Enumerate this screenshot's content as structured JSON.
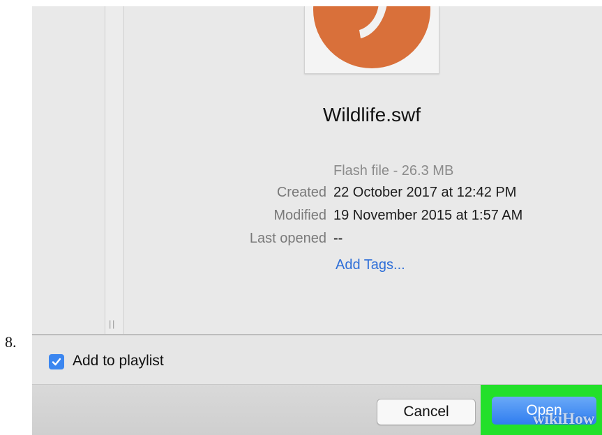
{
  "step": {
    "number": "8."
  },
  "file": {
    "name": "Wildlife.swf",
    "kind": "Flash file - 26.3 MB",
    "created_label": "Created",
    "created_value": "22 October 2017 at 12:42 PM",
    "modified_label": "Modified",
    "modified_value": "19 November 2015 at 1:57 AM",
    "last_opened_label": "Last opened",
    "last_opened_value": "--",
    "add_tags": "Add Tags..."
  },
  "options": {
    "add_to_playlist_label": "Add to playlist",
    "add_to_playlist_checked": true
  },
  "buttons": {
    "cancel": "Cancel",
    "open": "Open"
  },
  "watermark": "wikiHow",
  "colors": {
    "accent": "#3b86f0",
    "highlight": "#23e02a",
    "preview_icon": "#d9703a",
    "link": "#2f6fd8"
  },
  "icons": {
    "preview": "flash-file-icon",
    "checkbox": "checkmark-icon"
  }
}
